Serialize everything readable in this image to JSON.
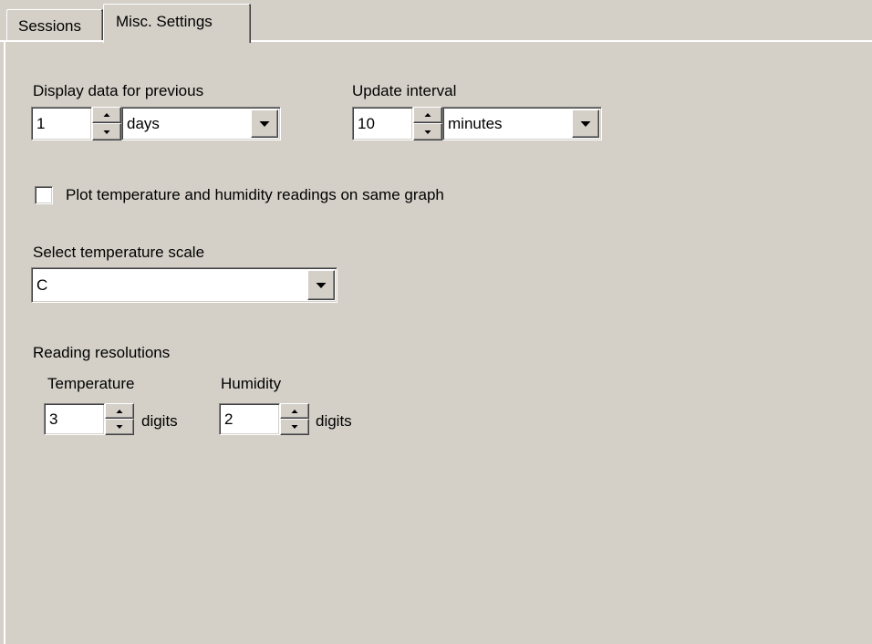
{
  "tabs": [
    {
      "label": "Sessions",
      "active": false
    },
    {
      "label": "Misc. Settings",
      "active": true
    }
  ],
  "display_data": {
    "label": "Display data for previous",
    "value": "1",
    "unit": "days"
  },
  "update_interval": {
    "label": "Update interval",
    "value": "10",
    "unit": "minutes"
  },
  "plot_same_graph": {
    "label": "Plot temperature and humidity readings on same graph",
    "checked": false
  },
  "temperature_scale": {
    "label": "Select temperature scale",
    "value": "C"
  },
  "reading_resolutions": {
    "label": "Reading resolutions",
    "temperature": {
      "label": "Temperature",
      "value": "3",
      "unit_label": "digits"
    },
    "humidity": {
      "label": "Humidity",
      "value": "2",
      "unit_label": "digits"
    }
  },
  "icons": {
    "spin_up": "up-arrow-icon",
    "spin_down": "down-arrow-icon",
    "dropdown": "chevron-down-icon"
  },
  "colors": {
    "dialog_face": "#d4d0c8",
    "field_background": "#ffffff",
    "shadow": "#808080",
    "highlight": "#ffffff"
  }
}
